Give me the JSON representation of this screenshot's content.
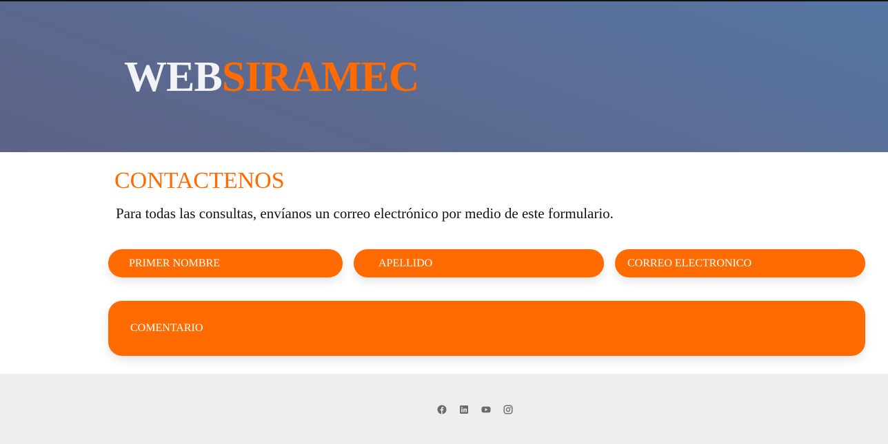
{
  "header": {
    "logo_part1": "WEB",
    "logo_part2": "SIRAMEC"
  },
  "contact": {
    "heading": "CONTACTENOS",
    "intro": "Para todas las consultas, envíanos un correo electrónico por medio de este formulario.",
    "fields": {
      "first_name_placeholder": "PRIMER NOMBRE",
      "last_name_placeholder": "APELLIDO",
      "email_placeholder": "CORREO ELECTRONICO",
      "comment_placeholder": "COMENTARIO"
    }
  },
  "footer": {
    "social_icons": [
      "facebook-icon",
      "linkedin-icon",
      "youtube-icon",
      "instagram-icon"
    ]
  },
  "colors": {
    "accent": "#ff6b00",
    "header_gradient_start": "#5676a3",
    "header_gradient_end": "#5c6387",
    "footer_bg": "#eeeeee",
    "icon_gray": "#6b6b6b"
  }
}
